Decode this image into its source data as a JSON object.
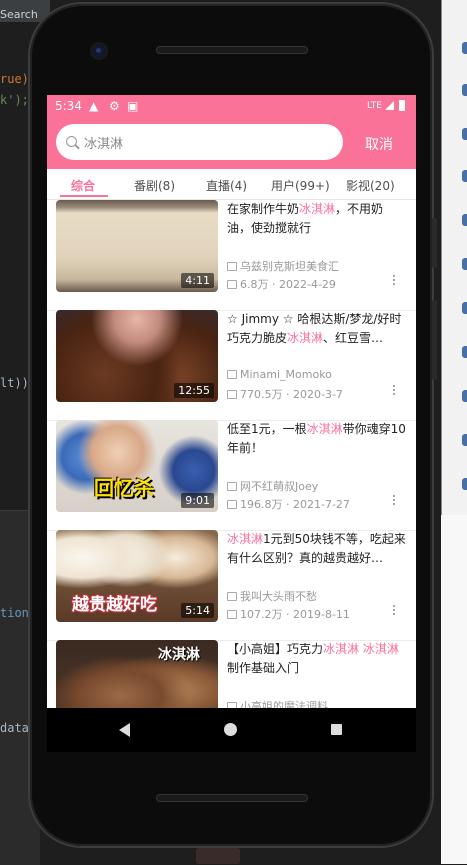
{
  "ide": {
    "search_label": "Search",
    "code_lines": [
      "rue)",
      "k');",
      "lt))",
      "tion",
      "data"
    ]
  },
  "status": {
    "time": "5:34",
    "network": "LTE"
  },
  "search": {
    "value": "冰淇淋",
    "cancel_label": "取消"
  },
  "tabs": [
    {
      "label": "综合"
    },
    {
      "label": "番剧(8)"
    },
    {
      "label": "直播(4)"
    },
    {
      "label": "用户(99+)"
    },
    {
      "label": "影视(20)"
    }
  ],
  "videos": [
    {
      "title_pre": "在家制作牛奶",
      "title_hl": "冰淇淋",
      "title_post": "，不用奶油，使劲搅就行",
      "title_hl2": "",
      "title_post2": "",
      "author": "乌兹别克斯坦美食汇",
      "views": "6.8万",
      "date": "2022-4-29",
      "duration": "4:11",
      "overlay": ""
    },
    {
      "title_pre": "☆ Jimmy ☆ 哈根达斯/梦龙/好时巧克力脆皮",
      "title_hl": "冰淇淋",
      "title_post": "、红豆雪…",
      "title_hl2": "",
      "title_post2": "",
      "author": "Minami_Momoko",
      "views": "770.5万",
      "date": "2020-3-7",
      "duration": "12:55",
      "overlay": ""
    },
    {
      "title_pre": "低至1元，一根",
      "title_hl": "冰淇淋",
      "title_post": "带你魂穿10年前！",
      "title_hl2": "",
      "title_post2": "",
      "author": "网不红萌叔Joey",
      "views": "196.8万",
      "date": "2021-7-27",
      "duration": "9:01",
      "overlay": "回忆杀"
    },
    {
      "title_pre": "",
      "title_hl": "冰淇淋",
      "title_post": "1元到50块钱不等，吃起来有什么区别？真的越贵越好…",
      "title_hl2": "",
      "title_post2": "",
      "author": "我叫大头雨不愁",
      "views": "107.2万",
      "date": "2019-8-11",
      "duration": "5:14",
      "overlay": "越贵越好吃"
    },
    {
      "title_pre": "【小高姐】巧克力",
      "title_hl": "冰淇淋",
      "title_post": " ",
      "title_hl2": "冰淇淋",
      "title_post2": "制作基础入门",
      "author": "小高姐的魔法调料",
      "views": "",
      "date": "",
      "duration": "",
      "overlay": "冰淇淋"
    }
  ],
  "colors": {
    "accent": "#fb7299"
  }
}
